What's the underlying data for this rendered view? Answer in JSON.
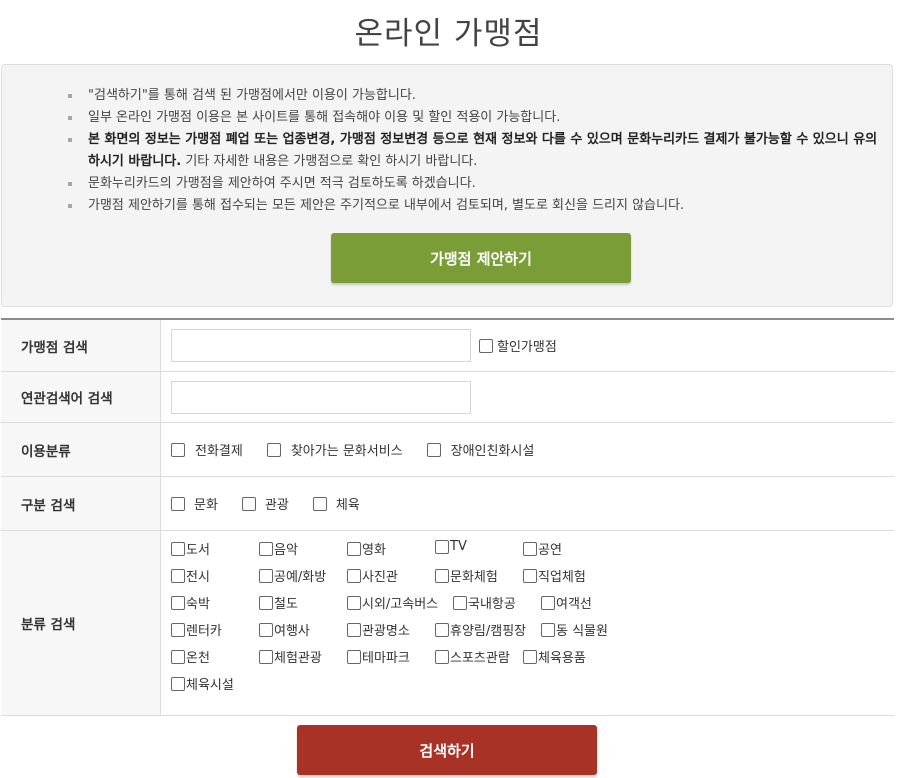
{
  "title": "온라인 가맹점",
  "notices": [
    {
      "bold": "",
      "text": "\"검색하기\"를 통해 검색 된 가맹점에서만 이용이 가능합니다."
    },
    {
      "bold": "",
      "text": "일부 온라인 가맹점 이용은 본 사이트를 통해 접속해야 이용 및 할인 적용이 가능합니다."
    },
    {
      "bold": "본 화면의 정보는 가맹점 폐업 또는 업종변경, 가맹점 정보변경 등으로 현재 정보와 다를 수 있으며 문화누리카드 결제가 불가능할 수 있으니 유의하시기 바랍니다.",
      "text": " 기타 자세한 내용은 가맹점으로 확인 하시기 바랍니다."
    },
    {
      "bold": "",
      "text": "문화누리카드의 가맹점을 제안하여 주시면 적극 검토하도록 하겠습니다."
    },
    {
      "bold": "",
      "text": "가맹점 제안하기를 통해 접수되는 모든 제안은 주기적으로 내부에서 검토되며, 별도로 회신을 드리지 않습니다."
    }
  ],
  "propose_button": "가맹점 제안하기",
  "rows": {
    "store_search": {
      "label": "가맹점 검색",
      "value": "",
      "discount_label": "할인가맹점"
    },
    "related_search": {
      "label": "연관검색어 검색",
      "value": ""
    },
    "usage": {
      "label": "이용분류",
      "options": [
        "전화결제",
        "찾아가는 문화서비스",
        "장애인친화시설"
      ]
    },
    "division": {
      "label": "구분 검색",
      "options": [
        "문화",
        "관광",
        "체육"
      ]
    },
    "category": {
      "label": "분류 검색",
      "options": [
        "도서",
        "음악",
        "영화",
        "TV",
        "공연",
        "전시",
        "공예/화방",
        "사진관",
        "문화체험",
        "직업체험",
        "숙박",
        "철도",
        "시외/고속버스",
        "국내항공",
        "여객선",
        "렌터카",
        "여행사",
        "관광명소",
        "휴양림/캠핑장",
        "동 식물원",
        "온천",
        "체험관광",
        "테마파크",
        "스포츠관람",
        "체육용품",
        "체육시설"
      ]
    }
  },
  "search_button": "검색하기"
}
